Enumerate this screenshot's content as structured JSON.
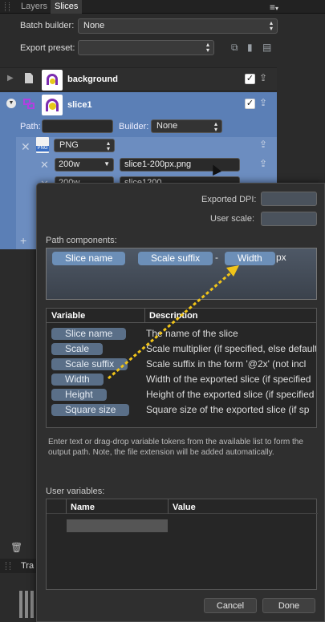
{
  "tabs": [
    "Layers",
    "Slices"
  ],
  "batch_builder": {
    "label": "Batch builder:",
    "value": "None"
  },
  "export_preset": {
    "label": "Export preset:",
    "value": ""
  },
  "slices": [
    {
      "name": "background"
    },
    {
      "name": "slice1",
      "path_label": "Path:",
      "builder_label": "Builder:",
      "builder_value": "None"
    }
  ],
  "export_format": "PNG",
  "exports": [
    {
      "size": "200w",
      "path": "slice1-200px.png"
    },
    {
      "size": "200w",
      "path": "slice1200"
    }
  ],
  "bottom_panel": {
    "tab": "Tra"
  },
  "dialog": {
    "exported_dpi_label": "Exported DPI:",
    "user_scale_label": "User scale:",
    "path_components_label": "Path components:",
    "path_tokens": [
      "Slice name",
      "Scale suffix",
      "Width"
    ],
    "path_separator": "-",
    "path_suffix": "px",
    "table_headers": [
      "Variable",
      "Description"
    ],
    "variables": [
      {
        "name": "Slice name",
        "desc": "The name of the slice"
      },
      {
        "name": "Scale",
        "desc": "Scale multiplier (if specified, else default"
      },
      {
        "name": "Scale suffix",
        "desc": "Scale suffix in the form '@2x' (not incl"
      },
      {
        "name": "Width",
        "desc": "Width of the exported slice (if specified"
      },
      {
        "name": "Height",
        "desc": "Height of the exported slice (if specified"
      },
      {
        "name": "Square size",
        "desc": "Square size of the exported slice (if sp"
      }
    ],
    "hint": "Enter text or drag-drop variable tokens from the available list to form the output path. Note, the file extension will be added automatically.",
    "user_variables_label": "User variables:",
    "user_headers": [
      "Name",
      "Value"
    ],
    "cancel_label": "Cancel",
    "done_label": "Done"
  },
  "colors": {
    "selected_row": "#5b7fb6",
    "token": "#6c8fb8",
    "drag_arrow": "#f0c419"
  }
}
